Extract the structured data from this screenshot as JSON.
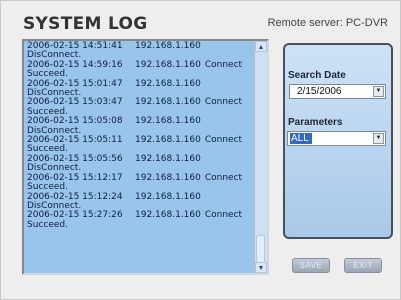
{
  "header": {
    "title": "SYSTEM LOG",
    "server_label": "Remote server: PC-DVR"
  },
  "log": {
    "entries": [
      {
        "datetime": "2006-02-15  14:51:41",
        "ip": "192.168.1.160",
        "action": "",
        "status": "DisConnect."
      },
      {
        "datetime": "2006-02-15  14:59:16",
        "ip": "192.168.1.160",
        "action": "Connect",
        "status": "Succeed."
      },
      {
        "datetime": "2006-02-15  15:01:47",
        "ip": "192.168.1.160",
        "action": "",
        "status": "DisConnect."
      },
      {
        "datetime": "2006-02-15  15:03:47",
        "ip": "192.168.1.160",
        "action": "Connect",
        "status": "Succeed."
      },
      {
        "datetime": "2006-02-15  15:05:08",
        "ip": "192.168.1.160",
        "action": "",
        "status": "DisConnect."
      },
      {
        "datetime": "2006-02-15  15:05:11",
        "ip": "192.168.1.160",
        "action": "Connect",
        "status": "Succeed."
      },
      {
        "datetime": "2006-02-15  15:05:56",
        "ip": "192.168.1.160",
        "action": "",
        "status": "DisConnect."
      },
      {
        "datetime": "2006-02-15  15:12:17",
        "ip": "192.168.1.160",
        "action": "Connect",
        "status": "Succeed."
      },
      {
        "datetime": "2006-02-15  15:12:24",
        "ip": "192.168.1.160",
        "action": "",
        "status": "DisConnect."
      },
      {
        "datetime": "2006-02-15  15:27:26",
        "ip": "192.168.1.160",
        "action": "Connect",
        "status": "Succeed."
      }
    ]
  },
  "filters": {
    "search_date_label": "Search Date",
    "search_date_value": "2/15/2006",
    "parameters_label": "Parameters",
    "parameters_value": "ALL"
  },
  "buttons": {
    "save_label": "SAVE",
    "exit_label": "EXIT"
  },
  "scrollbar": {
    "up_icon": "▲",
    "down_icon": "▼"
  },
  "dropdown_icon": "▼",
  "colors": {
    "log_background": "#99c4ec",
    "selection": "#316ac5"
  }
}
